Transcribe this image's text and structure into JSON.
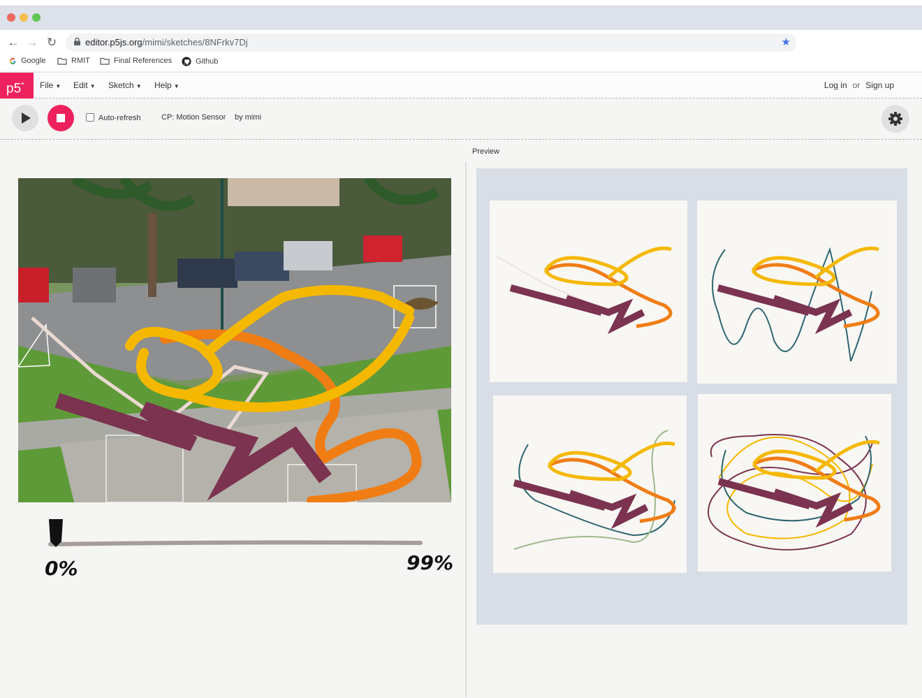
{
  "browser": {
    "url_host": "editor.p5js.org",
    "url_path": "/mimi/sketches/8NFrkv7Dj",
    "bookmarks": [
      "Google",
      "RMIT",
      "Final References",
      "Github"
    ]
  },
  "header": {
    "logo": "p5",
    "logo_mark": "*",
    "menu": [
      "File",
      "Edit",
      "Sketch",
      "Help"
    ],
    "login": "Log in",
    "or": "or",
    "signup": "Sign up"
  },
  "controls": {
    "auto_refresh_label": "Auto-refresh",
    "sketch_name": "CP: Motion Sensor",
    "author": "by mimi"
  },
  "preview": {
    "label": "Preview"
  },
  "slider": {
    "min_label": "0%",
    "max_label": "99%",
    "value": 0
  },
  "colors": {
    "accent": "#ed225d",
    "stroke_maroon": "#7b3350",
    "stroke_orange": "#f07d14",
    "stroke_yellow": "#f5b800",
    "stroke_teal": "#2f6670",
    "stroke_sage": "#9fb98c"
  },
  "icons": {
    "back": "arrow-left-icon",
    "forward": "arrow-right-icon",
    "reload": "reload-icon",
    "secure": "lock-icon",
    "bookmark": "star-icon",
    "settings": "gear-icon"
  }
}
